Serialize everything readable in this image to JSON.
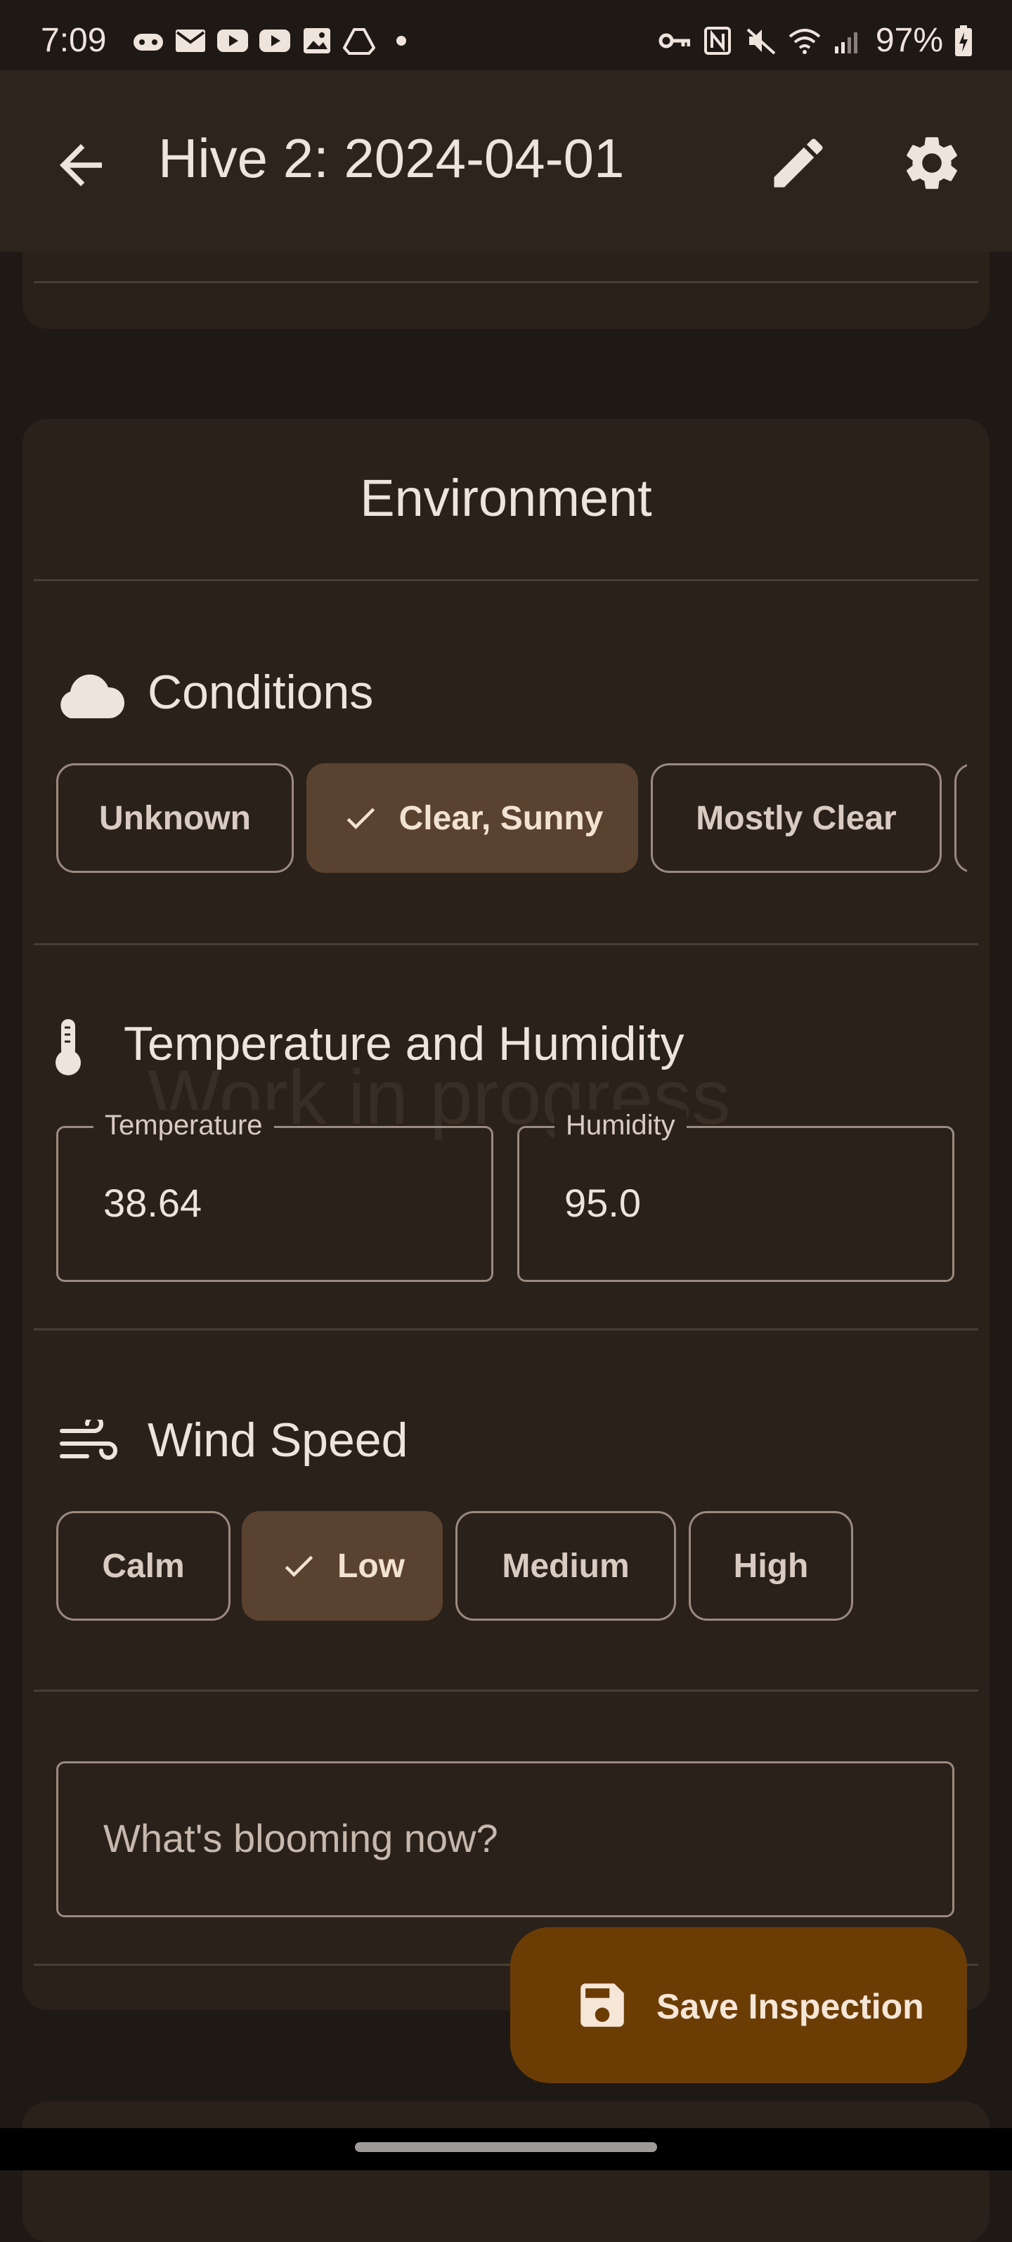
{
  "status_bar": {
    "time": "7:09",
    "battery": "97%",
    "left_icons": [
      "game-controller-icon",
      "mail-icon",
      "youtube-icon",
      "youtube-icon",
      "image-icon",
      "drive-icon",
      "dot-icon"
    ],
    "right_icons": [
      "vpn-key-icon",
      "nfc-icon",
      "mute-icon",
      "wifi-icon",
      "signal-icon",
      "battery-icon"
    ]
  },
  "app_bar": {
    "title": "Hive 2: 2024-04-01",
    "back_icon": "arrow-back-icon",
    "edit_icon": "pencil-icon",
    "settings_icon": "gear-icon"
  },
  "environment": {
    "heading": "Environment",
    "conditions": {
      "title": "Conditions",
      "icon": "cloud-icon",
      "options": [
        "Unknown",
        "Clear, Sunny",
        "Mostly Clear"
      ],
      "selected": "Clear, Sunny"
    },
    "temp_humidity": {
      "title": "Temperature and Humidity",
      "icon": "thermometer-icon",
      "temperature_label": "Temperature",
      "temperature_value": "38.64",
      "humidity_label": "Humidity",
      "humidity_value": "95.0",
      "watermark": "Work in progress"
    },
    "wind": {
      "title": "Wind Speed",
      "icon": "wind-icon",
      "options": [
        "Calm",
        "Low",
        "Medium",
        "High"
      ],
      "selected": "Low"
    },
    "blooming_placeholder": "What's blooming now?"
  },
  "fab": {
    "label": "Save Inspection",
    "icon": "floppy-disk-icon"
  },
  "colors": {
    "background": "#1f1915",
    "card": "#2a211b",
    "app_bar": "#2d241d",
    "selected_chip": "#5a4230",
    "fab": "#6b3d05"
  }
}
